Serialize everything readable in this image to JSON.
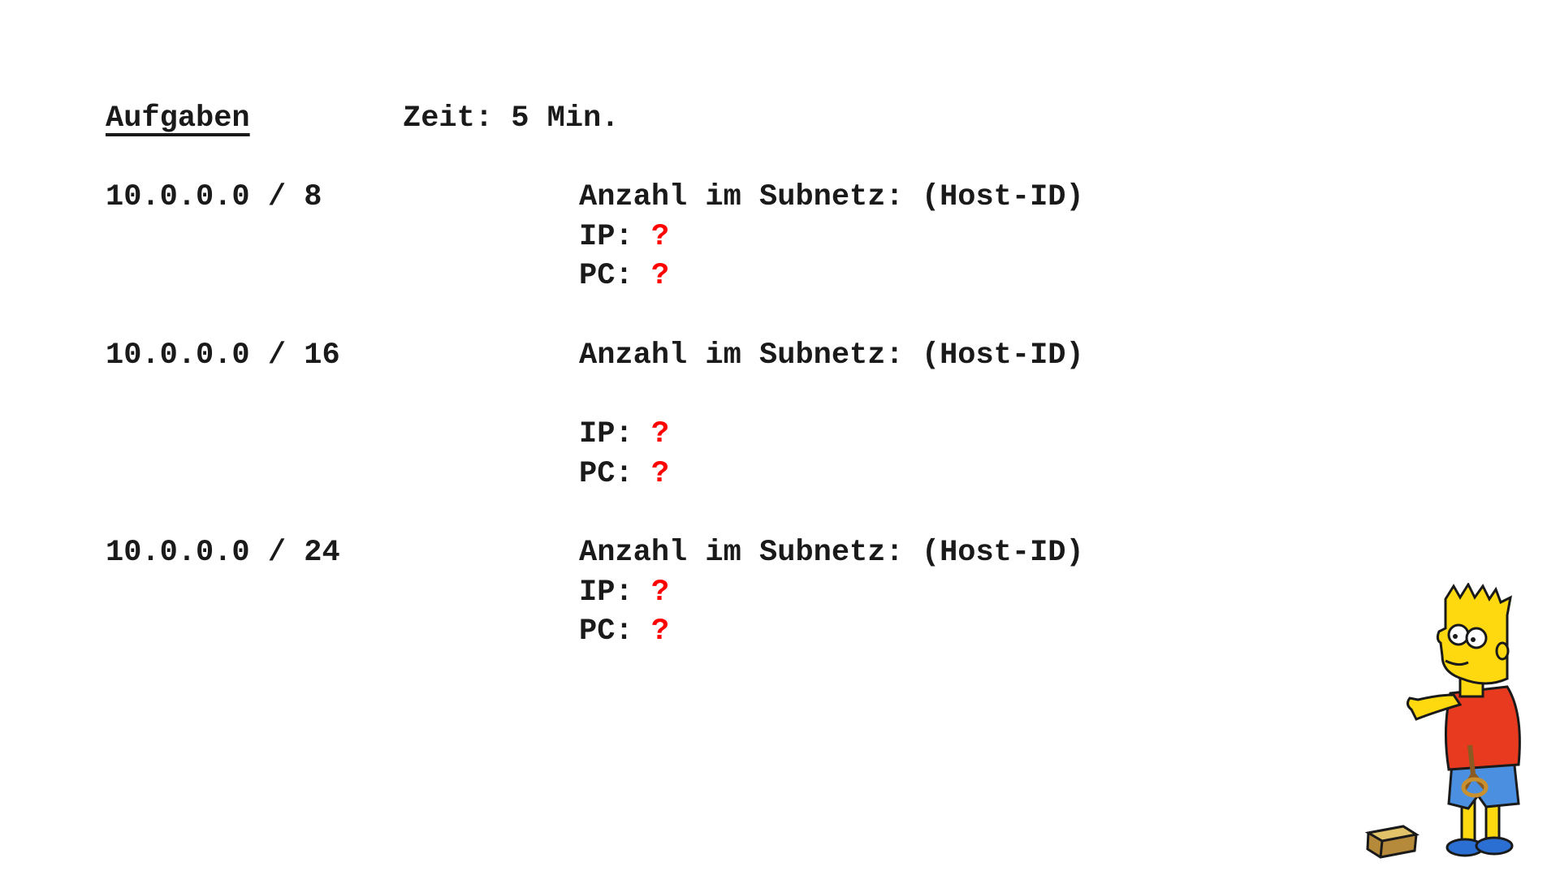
{
  "header": {
    "title": "Aufgaben",
    "time": "Zeit: 5 Min."
  },
  "tasks": [
    {
      "network": "10.0.0.0 / 8",
      "count_label": "Anzahl im Subnetz: (Host-ID)",
      "ip_label": "IP:",
      "ip_value": "?",
      "pc_label": "PC:",
      "pc_value": "?"
    },
    {
      "network": "10.0.0.0 / 16",
      "count_label": "Anzahl im Subnetz: (Host-ID)",
      "ip_label": "IP:",
      "ip_value": "?",
      "pc_label": "PC:",
      "pc_value": "?"
    },
    {
      "network": "10.0.0.0 / 24",
      "count_label": "Anzahl im Subnetz: (Host-ID)",
      "ip_label": "IP:",
      "ip_value": "?",
      "pc_label": "PC:",
      "pc_value": "?"
    }
  ],
  "colors": {
    "text": "#1a1a1a",
    "question_mark": "#ff0000",
    "background": "#ffffff"
  },
  "decoration": {
    "character_icon": "cartoon-character-with-slingshot"
  }
}
